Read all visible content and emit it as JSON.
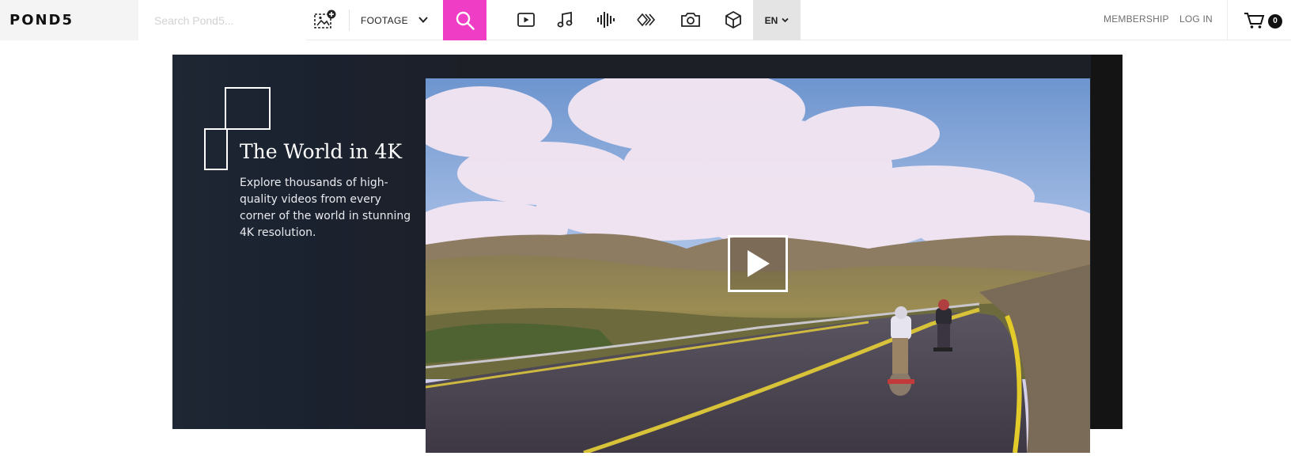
{
  "header": {
    "logo": "POND5",
    "search_placeholder": "Search Pond5...",
    "media_type": "FOOTAGE",
    "categories": [
      {
        "name": "video-icon"
      },
      {
        "name": "music-icon"
      },
      {
        "name": "sound-effects-icon"
      },
      {
        "name": "after-effects-icon"
      },
      {
        "name": "photo-icon"
      },
      {
        "name": "3d-model-icon"
      }
    ],
    "language": "EN",
    "membership_label": "MEMBERSHIP",
    "login_label": "LOG IN",
    "cart_count": "0"
  },
  "hero": {
    "title": "The World in 4K",
    "description": "Explore thousands of high-quality videos from every corner of the world in stunning 4K resolution."
  },
  "colors": {
    "accent": "#f03dc5",
    "hero_background": "#1c2029",
    "language_background": "#e4e4e4"
  }
}
